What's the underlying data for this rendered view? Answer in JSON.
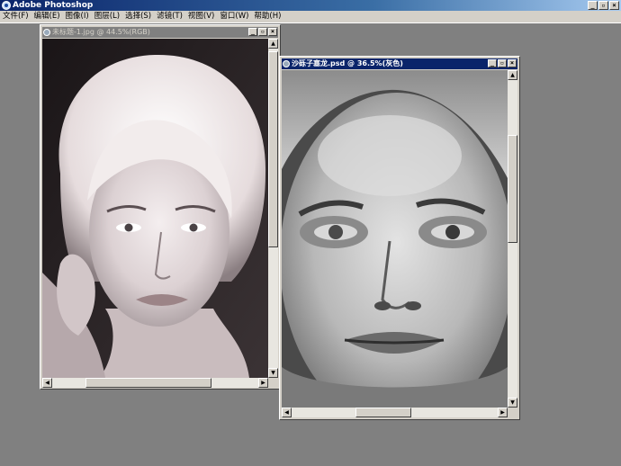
{
  "app": {
    "title": "Adobe Photoshop"
  },
  "menubar": {
    "items": [
      "文件(F)",
      "编辑(E)",
      "图像(I)",
      "图层(L)",
      "选择(S)",
      "滤镜(T)",
      "视图(V)",
      "窗口(W)",
      "帮助(H)"
    ]
  },
  "window_buttons": {
    "minimize": "_",
    "restore": "▫",
    "close": "×"
  },
  "doc1": {
    "title": "未标题-1.jpg @ 44.5%(RGB)"
  },
  "doc2": {
    "title": "沙砾子塞龙.psd @ 36.5%(灰色)"
  },
  "scroll": {
    "up": "▲",
    "down": "▼",
    "left": "◀",
    "right": "▶"
  }
}
